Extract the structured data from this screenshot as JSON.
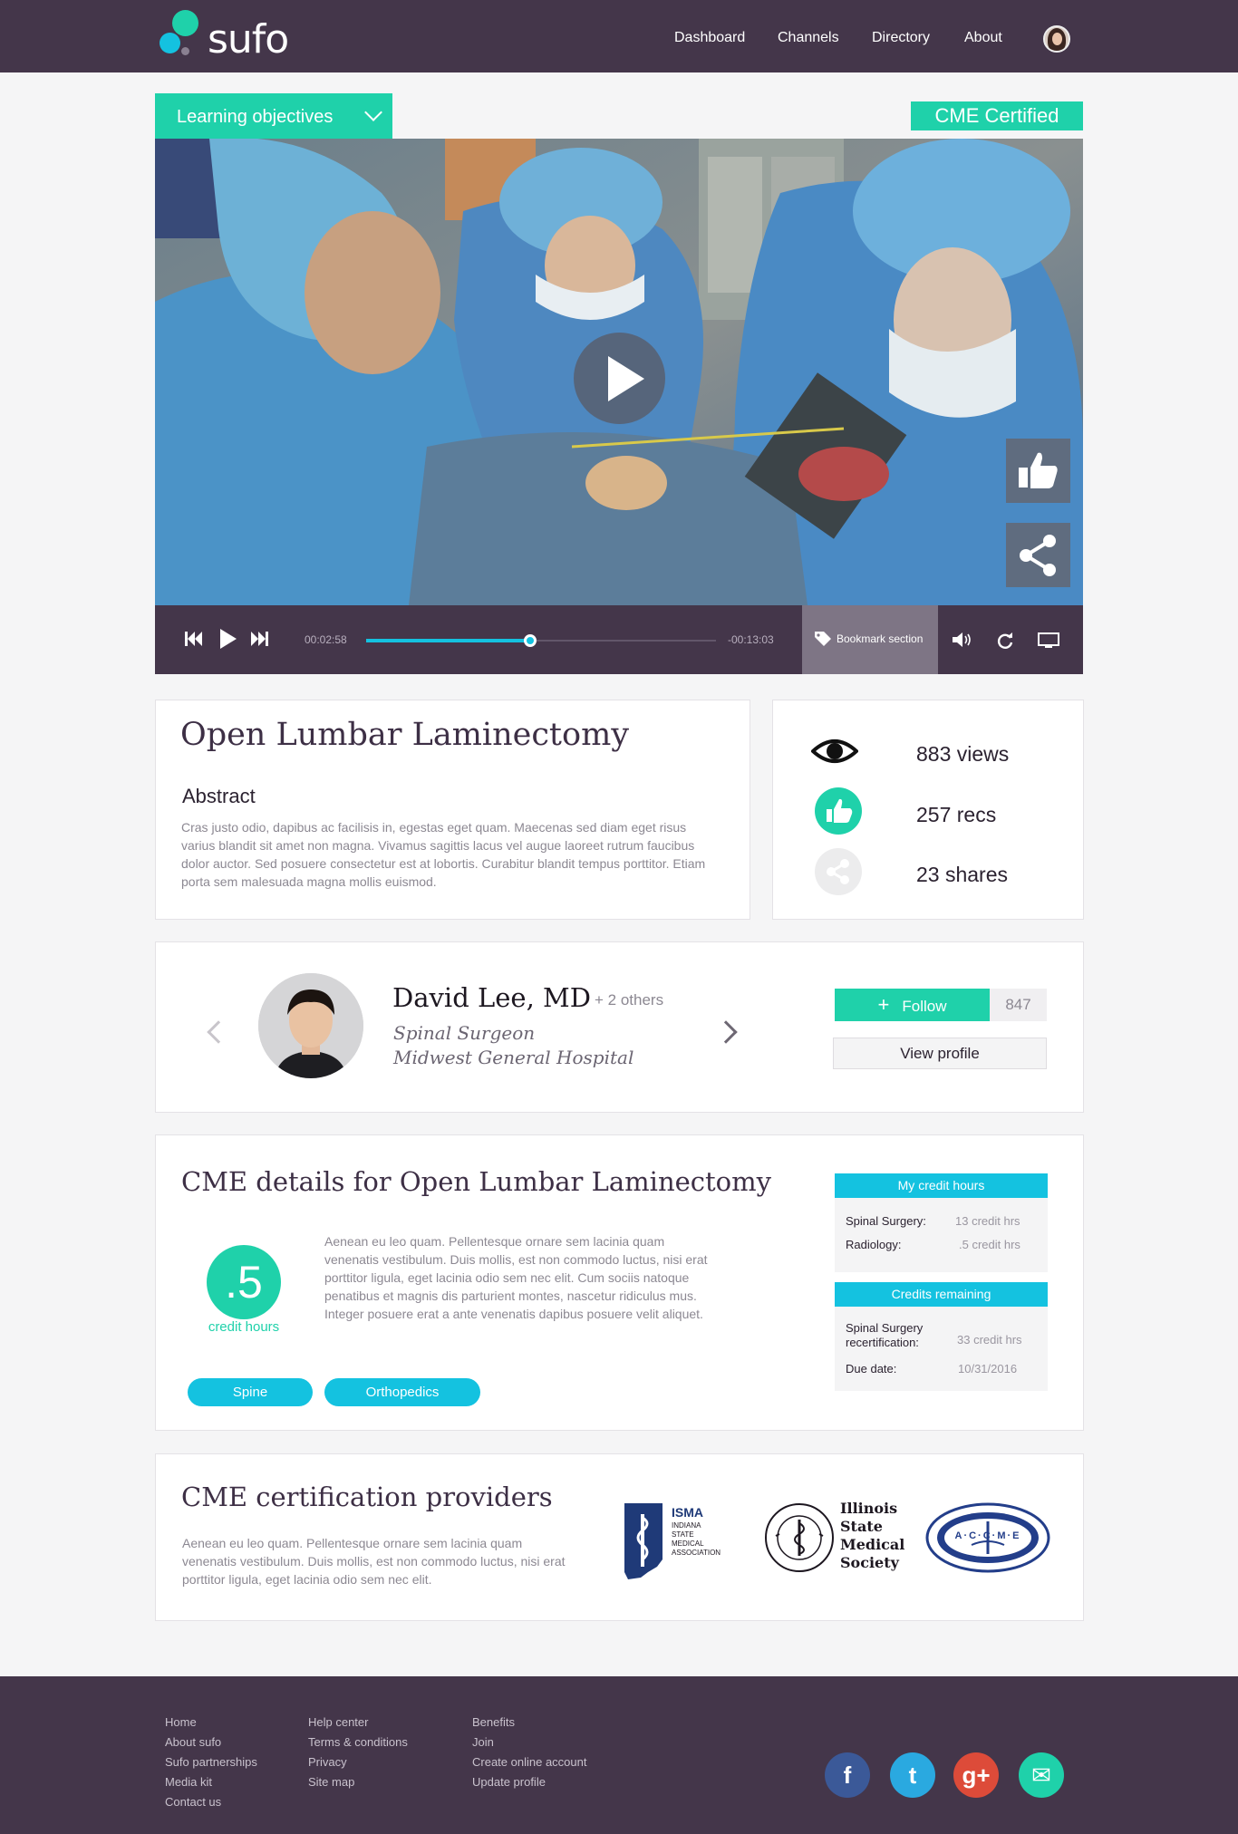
{
  "app": {
    "name": "sufo"
  },
  "nav": {
    "items": [
      "Dashboard",
      "Channels",
      "Directory",
      "About"
    ]
  },
  "video": {
    "learning_objectives_label": "Learning objectives",
    "cme_badge": "CME Certified",
    "elapsed": "00:02:58",
    "remaining": "-00:13:03",
    "progress": 0.47,
    "bookmark_label": "Bookmark section"
  },
  "course": {
    "title": "Open Lumbar Laminectomy",
    "abstract_heading": "Abstract",
    "abstract_text": "Cras justo odio, dapibus ac facilisis in, egestas eget quam. Maecenas sed diam eget risus varius blandit sit amet non magna. Vivamus sagittis lacus vel augue laoreet rutrum faucibus dolor auctor. Sed posuere consectetur est at lobortis. Curabitur blandit tempus porttitor. Etiam porta sem malesuada magna mollis euismod."
  },
  "stats": {
    "views": "883 views",
    "recs": "257 recs",
    "shares": "23 shares"
  },
  "author": {
    "name": "David Lee, MD",
    "others": "+ 2 others",
    "role": "Spinal Surgeon",
    "hospital": "Midwest General Hospital",
    "follow_label": "Follow",
    "follow_count": "847",
    "view_profile_label": "View profile"
  },
  "cme": {
    "title": "CME details for Open Lumbar Laminectomy",
    "credit_value": ".5",
    "credit_label": "credit hours",
    "description": "Aenean eu leo quam. Pellentesque ornare sem lacinia quam venenatis vestibulum. Duis mollis, est non commodo luctus, nisi erat porttitor ligula, eget lacinia odio sem nec elit. Cum sociis natoque penatibus et magnis dis parturient montes, nascetur ridiculus mus. Integer posuere erat a ante venenatis dapibus posuere velit aliquet.",
    "tags": [
      "Spine",
      "Orthopedics"
    ],
    "my_credit_hours": {
      "heading": "My credit hours",
      "rows": [
        {
          "label": "Spinal Surgery:",
          "value": "13 credit hrs"
        },
        {
          "label": "Radiology:",
          "value": ".5 credit hrs"
        }
      ]
    },
    "credits_remaining": {
      "heading": "Credits remaining",
      "rows": [
        {
          "label": "Spinal Surgery recertification:",
          "value": "33 credit hrs"
        },
        {
          "label": "Due date:",
          "value": "10/31/2016"
        }
      ]
    }
  },
  "providers": {
    "title": "CME certification providers",
    "description": "Aenean eu leo quam. Pellentesque ornare sem lacinia quam venenatis vestibulum. Duis mollis, est non commodo luctus, nisi erat porttitor ligula, eget lacinia odio sem nec elit.",
    "isma": {
      "abbr": "ISMA",
      "line1": "INDIANA",
      "line2": "STATE",
      "line3": "MEDICAL",
      "line4": "ASSOCIATION"
    },
    "illinois": {
      "line1": "Illinois",
      "line2": "State",
      "line3": "Medical",
      "line4": "Society"
    },
    "accme": {
      "text": "A·C·C·M·E"
    }
  },
  "footer": {
    "col1": [
      "Home",
      "About sufo",
      "Sufo partnerships",
      "Media kit",
      "Contact us"
    ],
    "col2": [
      "Help center",
      "Terms & conditions",
      "Privacy",
      "Site map"
    ],
    "col3": [
      "Benefits",
      "Join",
      "Create online account",
      "Update profile"
    ],
    "social": [
      {
        "icon": "facebook-icon",
        "glyph": "f",
        "color": "#3b5998"
      },
      {
        "icon": "twitter-icon",
        "glyph": "t",
        "color": "#2aa9e0"
      },
      {
        "icon": "google-plus-icon",
        "glyph": "g+",
        "color": "#dd4b39"
      },
      {
        "icon": "email-icon",
        "glyph": "✉",
        "color": "#1fd1aa"
      }
    ]
  },
  "colors": {
    "brand": "#44364a",
    "teal": "#1fd1aa",
    "cyan": "#14c2e0"
  }
}
